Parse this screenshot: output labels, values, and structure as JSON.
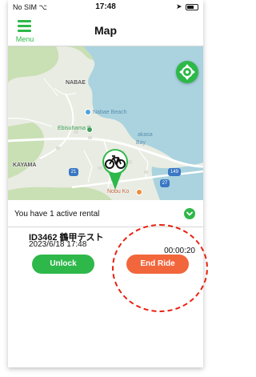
{
  "status_bar": {
    "carrier": "No SIM",
    "time": "17:48"
  },
  "nav": {
    "menu_label": "Menu",
    "title": "Map"
  },
  "map": {
    "labels": {
      "nabae": "NABAE",
      "nabae_beach": "Nabae Beach",
      "ebisuhama": "Ebisuhama P",
      "tsuruga_bay_1": "akasa",
      "tsuruga_bay_2": "Bay",
      "kayama": "KAYAMA",
      "nobu_ko": "Nobu Ko"
    },
    "route_shields": {
      "r21": "21",
      "r149": "149",
      "r27": "27"
    },
    "colors": {
      "water": "#aad3df",
      "land": "#e9ece2",
      "green": "#c9dfb4",
      "road": "#ffffff",
      "accent": "#2eb84a"
    }
  },
  "rental": {
    "message": "You have 1 active rental"
  },
  "active_ride": {
    "bike_id": "ID3462 鶴甲テスト",
    "start_datetime": "2023/6/18 17:48",
    "elapsed": "00:00:20",
    "unlock_label": "Unlock",
    "end_ride_label": "End Ride"
  },
  "colors": {
    "primary": "#2eb84a",
    "end_ride": "#f2663b",
    "highlight": "#e8210e"
  }
}
